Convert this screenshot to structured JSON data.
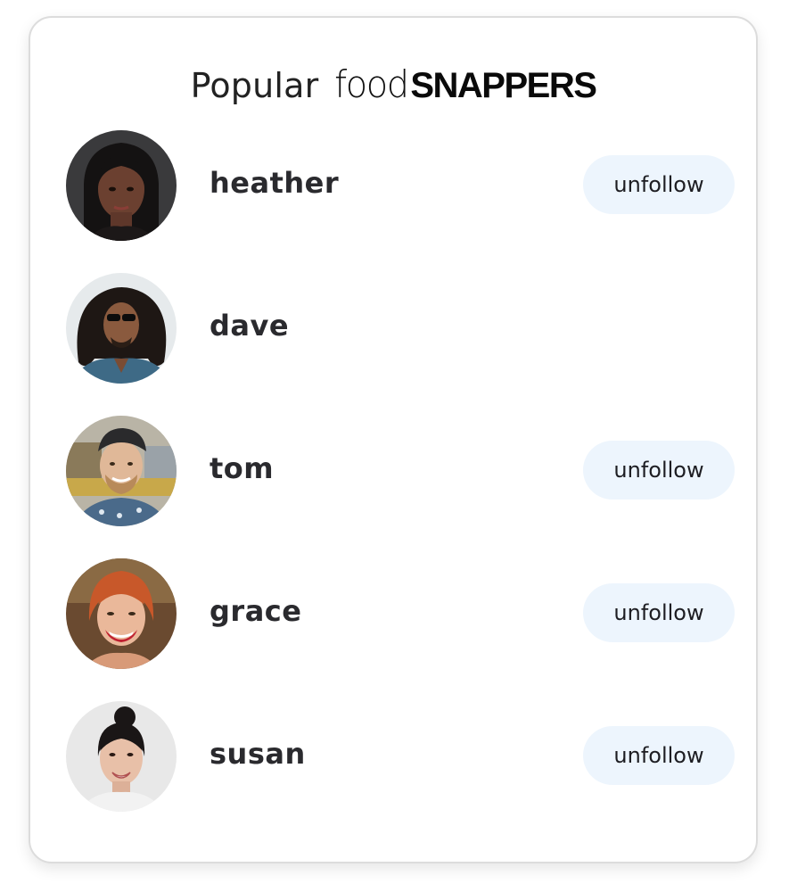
{
  "header": {
    "prefix": "Popular",
    "logo_light": "food",
    "logo_bold": "SNAPPERS"
  },
  "users": [
    {
      "name": "heather",
      "button": "unfollow",
      "avatar_icon": "heather-avatar-photo"
    },
    {
      "name": "dave",
      "button": null,
      "avatar_icon": "dave-avatar-photo"
    },
    {
      "name": "tom",
      "button": "unfollow",
      "avatar_icon": "tom-avatar-photo"
    },
    {
      "name": "grace",
      "button": "unfollow",
      "avatar_icon": "grace-avatar-photo"
    },
    {
      "name": "susan",
      "button": "unfollow",
      "avatar_icon": "susan-avatar-photo"
    }
  ],
  "colors": {
    "button_bg": "#edf5fd",
    "text": "#2a2a2e",
    "card_border": "#dcdcdc"
  }
}
